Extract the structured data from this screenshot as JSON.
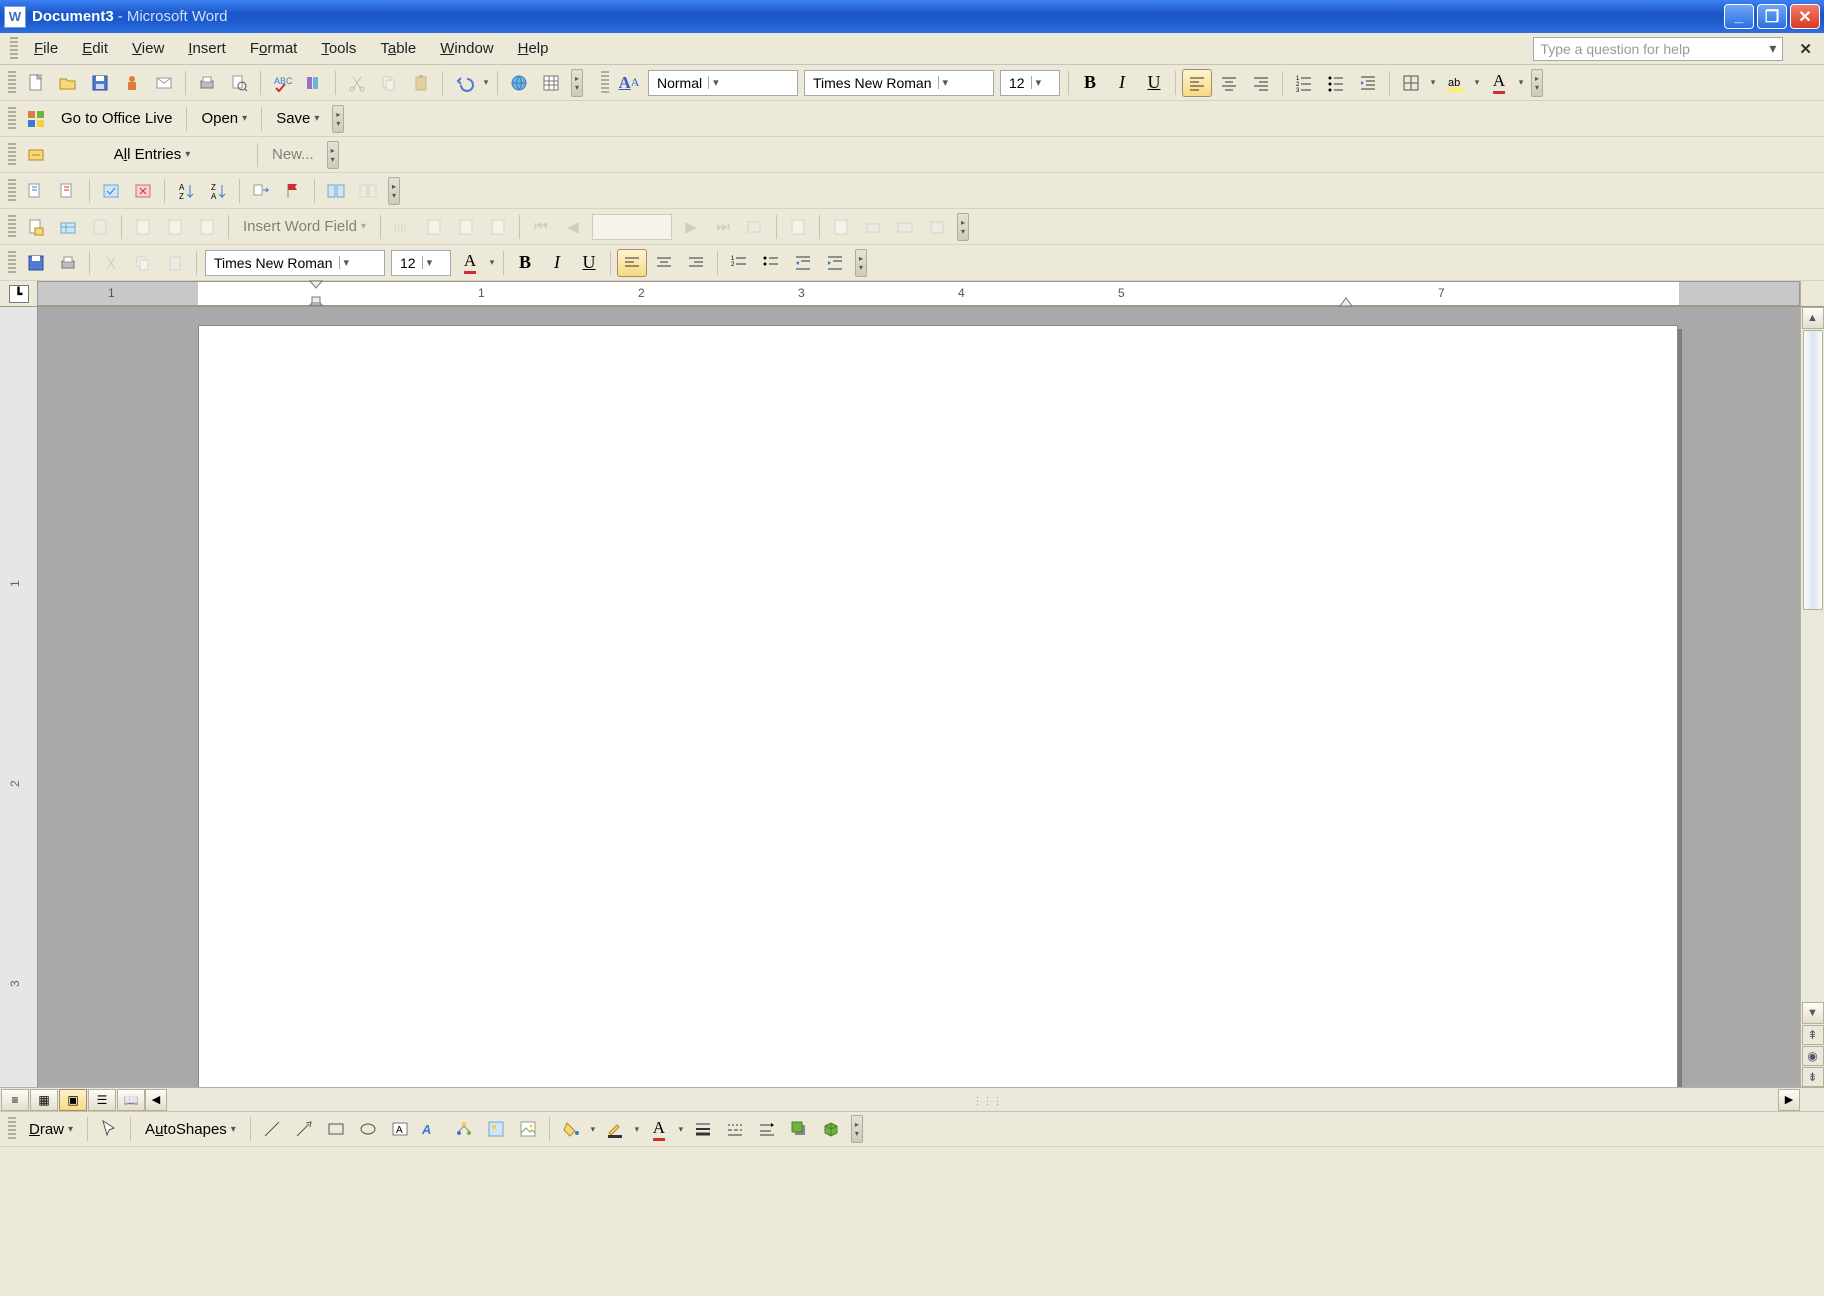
{
  "title": {
    "doc": "Document3",
    "sep": " - ",
    "app": "Microsoft Word"
  },
  "menu": {
    "file": "File",
    "edit": "Edit",
    "view": "View",
    "insert": "Insert",
    "format": "Format",
    "tools": "Tools",
    "table": "Table",
    "window": "Window",
    "help": "Help"
  },
  "helpbox": {
    "placeholder": "Type a question for help"
  },
  "formatting": {
    "style_label": "Normal",
    "font": "Times New Roman",
    "size": "12"
  },
  "officelive": {
    "goto": "Go to Office Live",
    "open": "Open",
    "save": "Save"
  },
  "autotext": {
    "all_entries": "All Entries",
    "new": "New..."
  },
  "mailmerge": {
    "insert_word_field": "Insert Word Field"
  },
  "fmt2": {
    "font": "Times New Roman",
    "size": "12"
  },
  "ruler": {
    "marks": [
      "1",
      "1",
      "2",
      "3",
      "4",
      "5",
      "7"
    ]
  },
  "draw": {
    "draw": "Draw",
    "autoshapes": "AutoShapes"
  },
  "colors": {
    "accent": "#1b58c9",
    "highlight": "#ffef66",
    "fontcolor": "#d12f2f",
    "toolbar_bg": "#ece9d8"
  }
}
